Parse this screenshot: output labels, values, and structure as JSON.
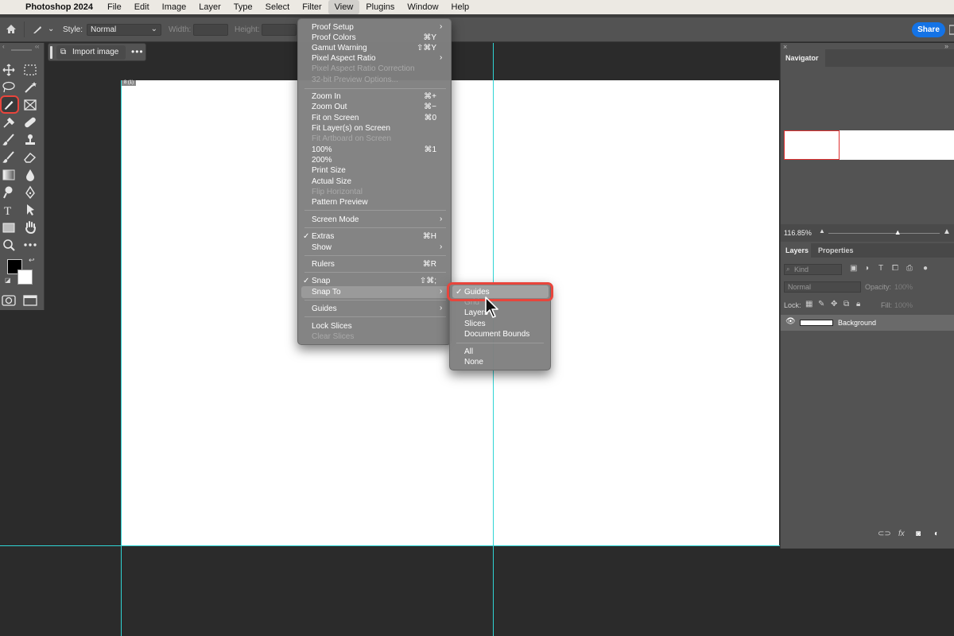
{
  "menubar": {
    "app": "Photoshop 2024",
    "items": [
      "File",
      "Edit",
      "Image",
      "Layer",
      "Type",
      "Select",
      "Filter",
      "View",
      "Plugins",
      "Window",
      "Help"
    ]
  },
  "options": {
    "style_label": "Style:",
    "style_value": "Normal",
    "width_label": "Width:",
    "height_label": "Height:",
    "share_label": "Share"
  },
  "contextual_bar": {
    "import_label": "Import image",
    "more": "•••"
  },
  "view_menu": {
    "items": [
      {
        "label": "Proof Setup",
        "submenu": true
      },
      {
        "label": "Proof Colors",
        "shortcut": "⌘Y"
      },
      {
        "label": "Gamut Warning",
        "shortcut": "⇧⌘Y"
      },
      {
        "label": "Pixel Aspect Ratio",
        "submenu": true
      },
      {
        "label": "Pixel Aspect Ratio Correction",
        "disabled": true
      },
      {
        "label": "32-bit Preview Options...",
        "disabled": true
      },
      {
        "label": "Zoom In",
        "shortcut": "⌘+"
      },
      {
        "label": "Zoom Out",
        "shortcut": "⌘−"
      },
      {
        "label": "Fit on Screen",
        "shortcut": "⌘0"
      },
      {
        "label": "Fit Layer(s) on Screen"
      },
      {
        "label": "Fit Artboard on Screen",
        "disabled": true
      },
      {
        "label": "100%",
        "shortcut": "⌘1"
      },
      {
        "label": "200%"
      },
      {
        "label": "Print Size"
      },
      {
        "label": "Actual Size"
      },
      {
        "label": "Flip Horizontal",
        "disabled": true
      },
      {
        "label": "Pattern Preview"
      },
      {
        "label": "Screen Mode",
        "submenu": true
      },
      {
        "label": "Extras",
        "shortcut": "⌘H",
        "checked": true
      },
      {
        "label": "Show",
        "submenu": true
      },
      {
        "label": "Rulers",
        "shortcut": "⌘R"
      },
      {
        "label": "Snap",
        "shortcut": "⇧⌘;",
        "checked": true
      },
      {
        "label": "Snap To",
        "submenu": true,
        "highlighted": true
      },
      {
        "label": "Guides",
        "submenu": true
      },
      {
        "label": "Lock Slices"
      },
      {
        "label": "Clear Slices",
        "disabled": true
      }
    ]
  },
  "snap_submenu": {
    "items": [
      {
        "label": "Guides",
        "checked": true
      },
      {
        "label": "Grid",
        "disabled": true
      },
      {
        "label": "Layers"
      },
      {
        "label": "Slices"
      },
      {
        "label": "Document Bounds"
      },
      {
        "label": "All"
      },
      {
        "label": "None"
      }
    ]
  },
  "canvas_tab": "8 (1)",
  "navigator": {
    "tab": "Navigator",
    "zoom": "116.85%",
    "zoom_fraction": 0.62
  },
  "layers": {
    "tabs": [
      "Layers",
      "Properties"
    ],
    "kind_label": "Kind",
    "blend_mode": "Normal",
    "opacity_label": "Opacity:",
    "opacity_value": "100%",
    "lock_label": "Lock:",
    "fill_label": "Fill:",
    "fill_value": "100%",
    "layer_name": "Background"
  },
  "colors": {
    "guide": "#2fd4d4",
    "highlight_ring": "#e8453c",
    "share": "#1473e6"
  }
}
